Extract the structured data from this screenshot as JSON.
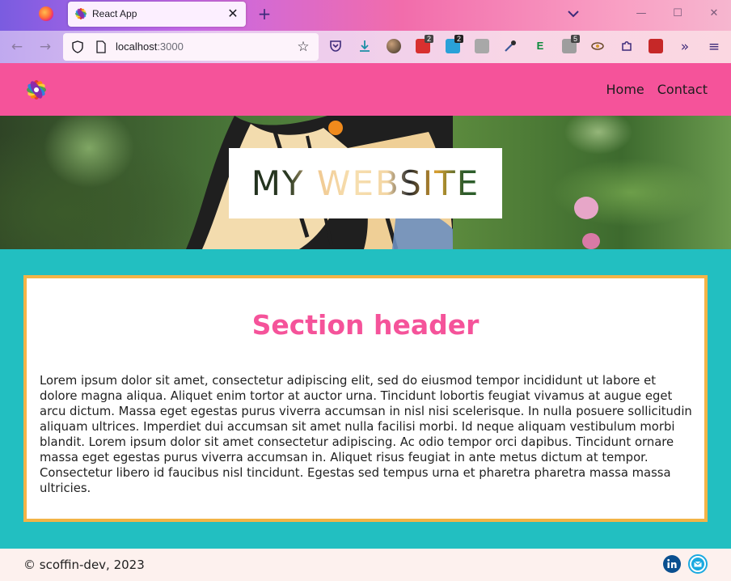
{
  "browser": {
    "tab_title": "React App",
    "url_host": "localhost",
    "url_port": ":3000",
    "extensions": [
      {
        "name": "todo-ext-icon",
        "badge": "2",
        "color": "#d8302f"
      },
      {
        "name": "shopping-ext-icon",
        "badge": "2",
        "color": "#2aa1d8"
      },
      {
        "name": "generic-ext-icon",
        "badge": "5",
        "color": "#9e9e9e"
      }
    ]
  },
  "site": {
    "nav": [
      {
        "label": "Home"
      },
      {
        "label": "Contact"
      }
    ],
    "hero_title": "MY WEBSITE",
    "section": {
      "header": "Section header",
      "body": "Lorem ipsum dolor sit amet, consectetur adipiscing elit, sed do eiusmod tempor incididunt ut labore et dolore magna aliqua. Aliquet enim tortor at auctor urna. Tincidunt lobortis feugiat vivamus at augue eget arcu dictum. Massa eget egestas purus viverra accumsan in nisl nisi scelerisque. In nulla posuere sollicitudin aliquam ultrices. Imperdiet dui accumsan sit amet nulla facilisi morbi. Id neque aliquam vestibulum morbi blandit. Lorem ipsum dolor sit amet consectetur adipiscing. Ac odio tempor orci dapibus. Tincidunt ornare massa eget egestas purus viverra accumsan in. Aliquet risus feugiat in ante metus dictum at tempor. Consectetur libero id faucibus nisl tincidunt. Egestas sed tempus urna et pharetra pharetra massa massa ultricies."
    },
    "footer": "© scoffin-dev, 2023",
    "socials": [
      {
        "name": "linkedin-icon",
        "color": "#0a66c2"
      },
      {
        "name": "email-icon",
        "color": "#1aa9e0"
      }
    ]
  },
  "colors": {
    "header_pink": "#f5539a",
    "teal": "#22bfc1",
    "card_border": "#f3b447"
  }
}
